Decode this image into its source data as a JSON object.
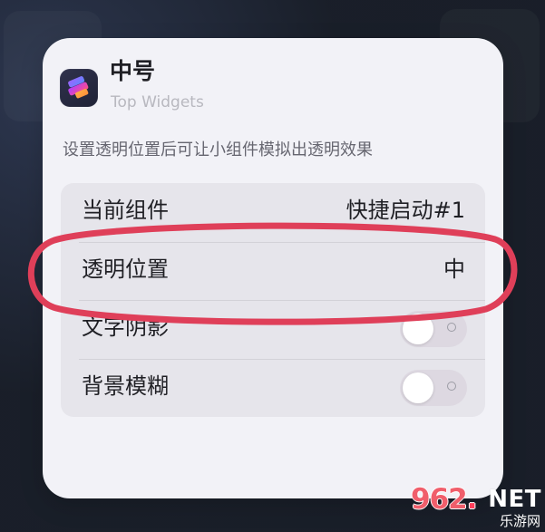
{
  "widget": {
    "title": "中号",
    "app_name": "Top Widgets",
    "description": "设置透明位置后可让小组件模拟出透明效果",
    "icon_name": "stacked-cards-app-icon"
  },
  "settings": [
    {
      "label": "当前组件",
      "value": "快捷启动#1",
      "kind": "value"
    },
    {
      "label": "透明位置",
      "value": "中",
      "kind": "value"
    },
    {
      "label": "文字阴影",
      "state": "off",
      "kind": "toggle"
    },
    {
      "label": "背景模糊",
      "state": "off",
      "kind": "toggle"
    }
  ],
  "watermark": {
    "main_prefix": "962",
    "main_dot": ".",
    "main_suffix": "NET",
    "sub": "乐游网"
  },
  "colors": {
    "highlight_ellipse": "#df3f59",
    "card_background": "#f2f2f7",
    "settings_background": "#e6e5eb"
  }
}
